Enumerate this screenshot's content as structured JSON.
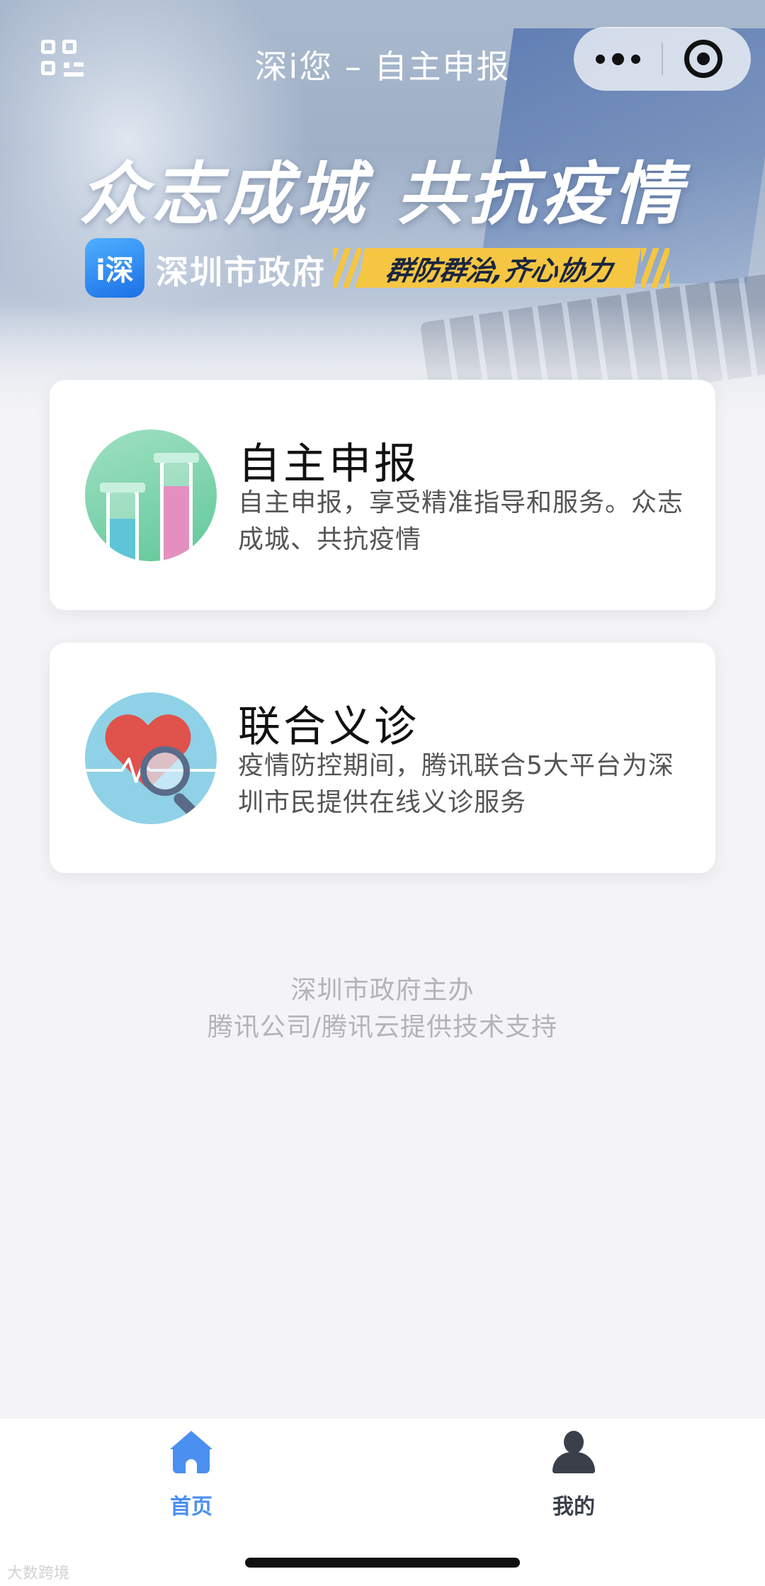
{
  "nav": {
    "title": "深i您 – 自主申报"
  },
  "banner": {
    "slogan": "众志成城 共抗疫情",
    "gov_logo_char": "i深",
    "gov_name": "深圳市政府",
    "tagline": "群防群治,齐心协力"
  },
  "services": [
    {
      "title": "自主申报",
      "description": "自主申报，享受精准指导和服务。众志成城、共抗疫情",
      "icon": "test-tubes-icon"
    },
    {
      "title": "联合义诊",
      "description": "疫情防控期间，腾讯联合5大平台为深圳市民提供在线义诊服务",
      "icon": "heart-magnifier-icon"
    }
  ],
  "credits": {
    "line1": "深圳市政府主办",
    "line2": "腾讯公司/腾讯云提供技术支持"
  },
  "tabbar": {
    "items": [
      {
        "label": "首页",
        "icon": "home-icon",
        "active": true
      },
      {
        "label": "我的",
        "icon": "person-icon",
        "active": false
      }
    ]
  },
  "colors": {
    "accent": "#4b8ff0",
    "tagline_bg": "#f5c642",
    "tab_inactive": "#3a3f4a",
    "credit_text": "#b3b3b8"
  },
  "watermark": "大数跨境"
}
